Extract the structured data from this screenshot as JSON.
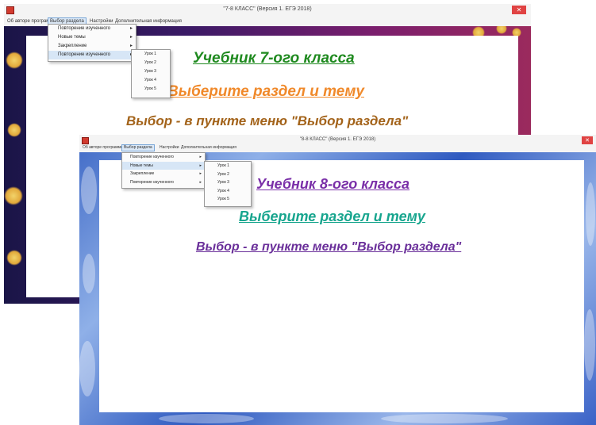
{
  "win7": {
    "title": "\"7-8 КЛАСС\" (Версия 1. ЕГЭ 2018)",
    "close_label": "✕",
    "menu": [
      "Об авторе программы",
      "Выбор раздела",
      "Настройки",
      "Дополнительная информация"
    ],
    "dropdown": [
      "Повторение изученного",
      "Новые темы",
      "Закрепление",
      "Повторение изученного"
    ],
    "submenu": [
      "Урок 1",
      "Урок 2",
      "Урок 3",
      "Урок 4",
      "Урок 5"
    ],
    "headline1": "Учебник 7-ого класса",
    "headline2": "Выберите раздел и тему",
    "headline3": "Выбор - в пункте меню \"Выбор раздела\"",
    "colors": {
      "headline1": "#1f8a1f",
      "headline2": "#f0892a",
      "headline3": "#a3631a"
    }
  },
  "win8": {
    "title": "\"8-8 КЛАСС\" (Версия 1. ЕГЭ 2018)",
    "close_label": "✕",
    "menu": [
      "Об авторе программы",
      "Выбор раздела",
      "Настройки",
      "Дополнительная информация"
    ],
    "dropdown": [
      "Повторение изученного",
      "Новые темы",
      "Закрепление",
      "Повторение изученного"
    ],
    "submenu": [
      "Урок 1",
      "Урок 2",
      "Урок 3",
      "Урок 4",
      "Урок 5"
    ],
    "headline1": "Учебник 8-ого класса",
    "headline2": "Выберите раздел и тему",
    "headline3": "Выбор - в пункте меню \"Выбор раздела\"",
    "colors": {
      "headline1": "#7a2fa8",
      "headline2": "#17a58e",
      "headline3": "#6a2f9a"
    }
  }
}
